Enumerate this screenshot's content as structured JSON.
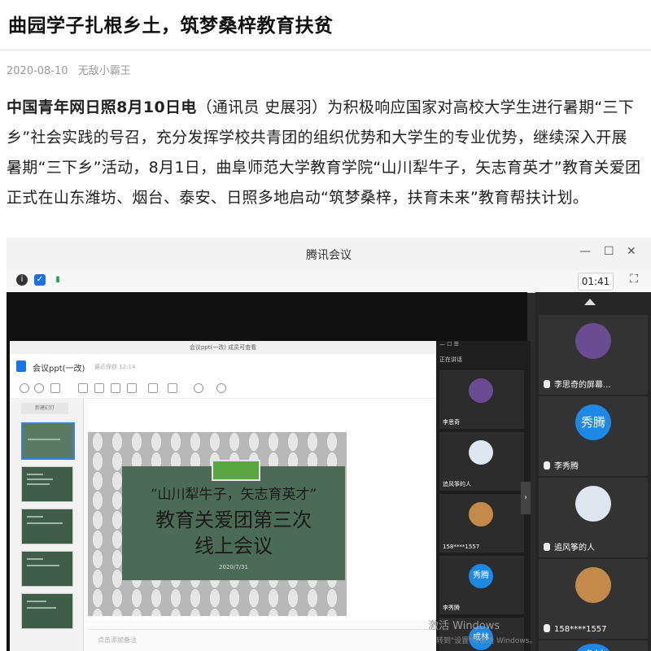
{
  "article": {
    "title": "曲园学子扎根乡土，筑梦桑梓教育扶贫",
    "date": "2020-08-10",
    "author": "无敌小霸王",
    "lead": "中国青年网日照8月10日电",
    "body": "（通讯员 史展羽）为积极响应国家对高校大学生进行暑期“三下乡”社会实践的号召，充分发挥学校共青团的组织优势和大学生的专业优势，继续深入开展暑期“三下乡”活动，8月1日，曲阜师范大学教育学院“山川犁牛子，矢志育英才”教育关爱团正式在山东潍坊、烟台、泰安、日照多地启动“筑梦桑梓，扶育未来”教育帮扶计划。"
  },
  "meeting": {
    "window_title": "腾讯会议",
    "timer": "01:41",
    "win_controls": [
      "—",
      "☐",
      "✕"
    ],
    "ppt": {
      "top_caption": "会议ppt(一改)  成员可查看",
      "doc_name": "会议ppt(一改)",
      "saved": "最近保存 12:14",
      "thumb_button": "新建幻灯",
      "notes_placeholder": "点击添加备注"
    },
    "slide": {
      "line1": "“山川犁牛子，矢志育英才”",
      "line2": "教育关爱团第三次",
      "line3": "线上会议",
      "date": "2020/7/31"
    },
    "mid_panel": {
      "header": "正在讲话",
      "tiles": [
        {
          "name": "李思奇",
          "avatar_color": "#6a4c93"
        },
        {
          "name": "追风筝的人",
          "avatar_color": "#e0e6ef"
        },
        {
          "name": "158****1557",
          "avatar_color": "#c48a4a"
        },
        {
          "name": "李秀腾",
          "avatar_text": "秀腾",
          "avatar_color": "#1e88e5"
        }
      ],
      "partial_tile_text": "成林"
    },
    "right_panel": {
      "tiles": [
        {
          "name": "李思奇的屏幕...",
          "avatar_color": "#6a4c93"
        },
        {
          "name": "李秀腾",
          "avatar_text": "秀腾",
          "avatar_color": "#1e88e5"
        },
        {
          "name": "追风筝的人",
          "avatar_color": "#e0e6ef"
        },
        {
          "name": "158****1557",
          "avatar_color": "#c48a4a"
        }
      ],
      "partial_tile_text": "成林"
    },
    "watermark": {
      "line1": "激活 Windows",
      "line2": "转到\"设置\"以激活 Windows。"
    },
    "icons": [
      "info-icon",
      "shield-icon",
      "signal-icon",
      "fullscreen-icon",
      "scroll-up-icon",
      "scroll-right-icon"
    ]
  }
}
